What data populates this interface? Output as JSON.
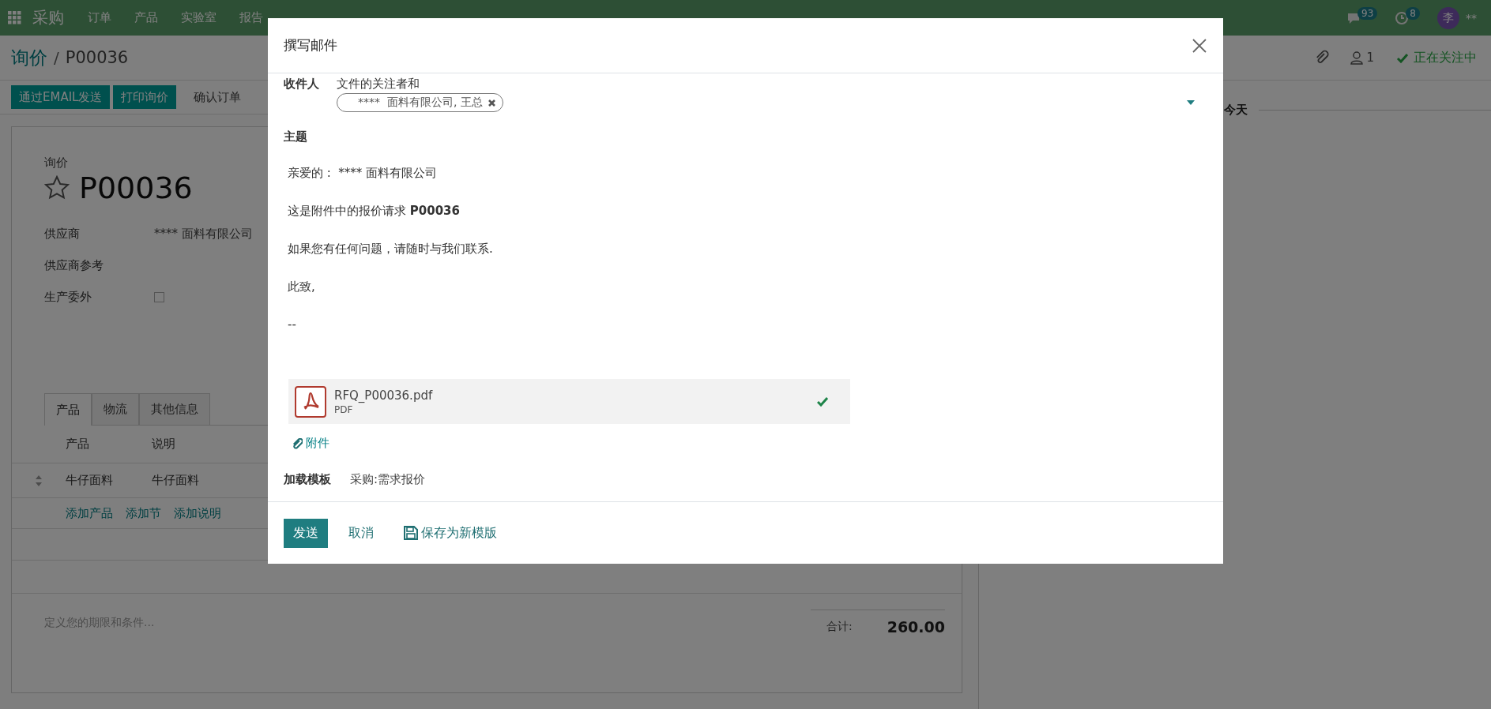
{
  "navbar": {
    "app": "采购",
    "menu": [
      "订单",
      "产品",
      "实验室",
      "报告"
    ],
    "messages_count": "93",
    "activities_count": "8",
    "avatar": "李",
    "user": "**"
  },
  "breadcrumb": {
    "parent": "询价",
    "separator": "/",
    "current": "P00036"
  },
  "chatter_top": {
    "followers": "1",
    "follow_label": "正在关注中"
  },
  "actions": [
    {
      "label": "通过EMAIL发送",
      "kind": "primary"
    },
    {
      "label": "打印询价",
      "kind": "primary"
    },
    {
      "label": "确认订单",
      "kind": "secondary"
    }
  ],
  "form": {
    "type_label": "询价",
    "name": "P00036",
    "starred": false,
    "fields": [
      {
        "label": "供应商",
        "kind": "text",
        "value": "**** 面料有限公司"
      },
      {
        "label": "供应商参考",
        "kind": "text"
      },
      {
        "label": "生产委外",
        "kind": "checkbox",
        "checked": false
      }
    ],
    "tabs": [
      {
        "label": "产品",
        "selected": true
      },
      {
        "label": "物流",
        "selected": false
      },
      {
        "label": "其他信息",
        "selected": false
      }
    ],
    "columns": [
      "产品",
      "说明"
    ],
    "rows": [
      [
        "牛仔面料",
        "牛仔面料"
      ]
    ],
    "add_links": [
      "添加产品",
      "添加节",
      "添加说明"
    ],
    "terms_placeholder": "定义您的期限和条件...",
    "total_label": "合计:",
    "total": "260.00"
  },
  "chatter": {
    "date_separator": "今天"
  },
  "dialog": {
    "title": "撰写邮件",
    "recipients_label": "收件人",
    "recipients_intro": "文件的关注者和",
    "recipients": [
      {
        "label": "****  面料有限公司, 王总"
      }
    ],
    "subject_label": "主题",
    "body": [
      "亲爱的 :  **** 面料有限公司",
      "这是附件中的报价请求 **P00036**",
      "如果您有任何问题，请随时与我们联系.",
      "此致,",
      "--"
    ],
    "attachments": [
      {
        "name": "RFQ_P00036.pdf",
        "type": "PDF",
        "uploaded": true
      }
    ],
    "attach_link": "附件",
    "template_label": "加载模板",
    "template": "采购:需求报价",
    "buttons": [
      {
        "label": "发送",
        "kind": "primary"
      },
      {
        "label": "取消",
        "kind": "link"
      },
      {
        "label": "保存为新模版",
        "kind": "save"
      }
    ]
  }
}
